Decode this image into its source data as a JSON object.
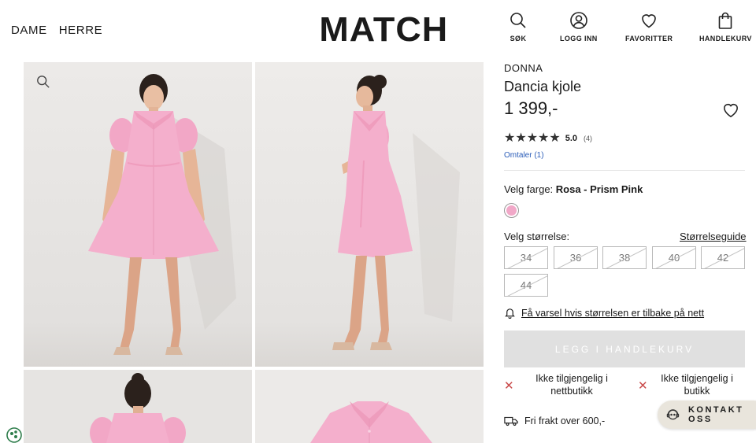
{
  "header": {
    "nav": [
      "DAME",
      "HERRE"
    ],
    "logo": "MATCH",
    "icons": [
      {
        "name": "search-icon",
        "label": "SØK"
      },
      {
        "name": "user-icon",
        "label": "LOGG INN"
      },
      {
        "name": "heart-icon",
        "label": "FAVORITTER"
      },
      {
        "name": "bag-icon",
        "label": "HANDLEKURV"
      }
    ]
  },
  "product": {
    "brand": "DONNA",
    "name": "Dancia kjole",
    "price": "1 399,-",
    "rating": "5.0",
    "rating_count": "(4)",
    "reviews_link": "Omtaler (1)",
    "color_label": "Velg farge:",
    "color_value": "Rosa - Prism Pink",
    "swatch_color": "#f1a8c8",
    "size_label": "Velg størrelse:",
    "size_guide": "Størrelseguide",
    "sizes": [
      "34",
      "36",
      "38",
      "40",
      "42",
      "44"
    ],
    "notify": "Få varsel hvis størrelsen er tilbake på nett",
    "add_to_cart": "LEGG I HANDLEKURV",
    "availability_online": [
      "Ikke tilgjengelig i",
      "nettbutikk"
    ],
    "availability_store": [
      "Ikke tilgjengelig i",
      "butikk"
    ],
    "shipping": "Fri frakt over 600,-"
  },
  "contact": "KONTAKT OSS"
}
